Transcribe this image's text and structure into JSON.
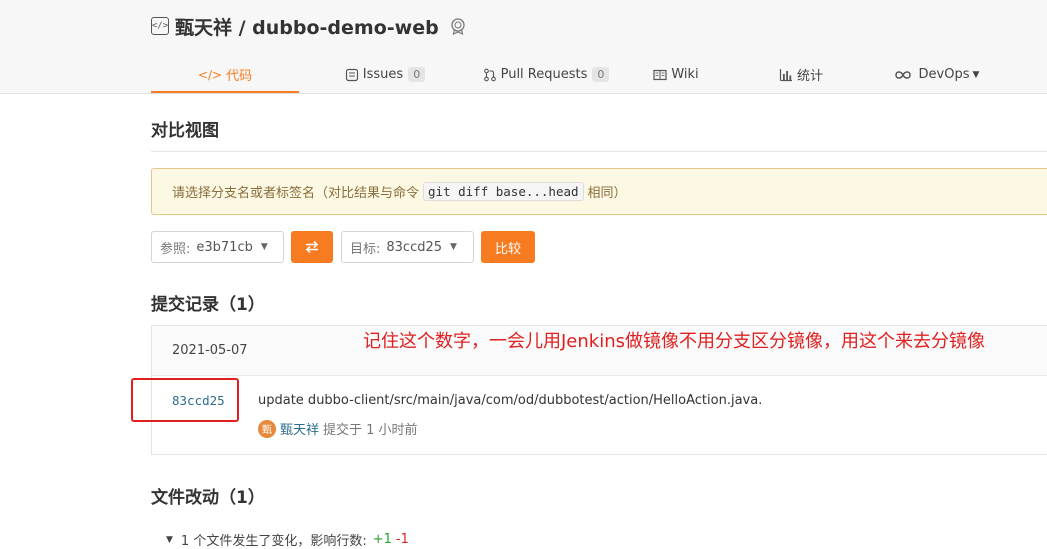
{
  "repo": {
    "title": "甄天祥 / dubbo-demo-web",
    "icon": "code-bracket-icon",
    "badge_icon": "award-icon"
  },
  "tabs": [
    {
      "label": "代码",
      "icon": "</>",
      "active": true
    },
    {
      "label": "Issues",
      "count": "0",
      "icon": "issue-icon"
    },
    {
      "label": "Pull Requests",
      "count": "0",
      "icon": "pull-request-icon"
    },
    {
      "label": "Wiki",
      "icon": "book-icon"
    },
    {
      "label": "统计",
      "icon": "bar-chart-icon"
    },
    {
      "label": "DevOps",
      "icon": "infinity-icon",
      "dropdown": true
    }
  ],
  "compare": {
    "title": "对比视图",
    "notice_before": "请选择分支名或者标签名（对比结果与命令",
    "notice_code": "git diff base...head",
    "notice_after": "相同）",
    "base_label": "参照:",
    "base_value": "e3b71cb",
    "swap_icon": "swap-arrows-icon",
    "target_label": "目标:",
    "target_value": "83ccd25",
    "compare_button": "比较"
  },
  "commits": {
    "title": "提交记录（1）",
    "date": "2021-05-07",
    "sha": "83ccd25",
    "message": "update dubbo-client/src/main/java/com/od/dubbotest/action/HelloAction.java.",
    "author_avatar": "甄",
    "author": "甄天祥",
    "committed": "提交于 1 小时前"
  },
  "annotation": "记住这个数字，一会儿用Jenkins做镜像不用分支区分镜像，用这个来去分镜像",
  "files": {
    "title": "文件改动（1）",
    "summary": "1 个文件发生了变化，影响行数:",
    "additions": "+1",
    "deletions": "-1"
  },
  "colors": {
    "accent": "#f77b20",
    "annotation_red": "#e02020",
    "link": "#2a6d8f"
  }
}
